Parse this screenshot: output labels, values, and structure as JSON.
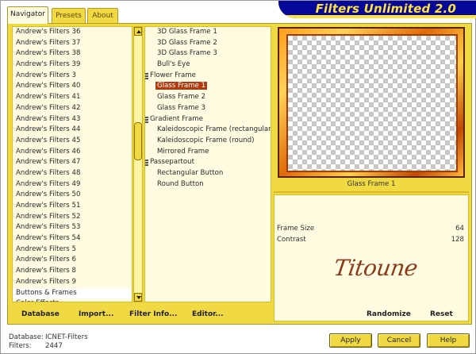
{
  "tabs": [
    {
      "label": "Navigator",
      "active": true
    },
    {
      "label": "Presets",
      "active": false
    },
    {
      "label": "About",
      "active": false
    }
  ],
  "logo_text": "Filters Unlimited 2.0",
  "categories": [
    "Andrew's Filters 36",
    "Andrew's Filters 37",
    "Andrew's Filters 38",
    "Andrew's Filters 39",
    "Andrew's Filters 3",
    "Andrew's Filters 40",
    "Andrew's Filters 41",
    "Andrew's Filters 42",
    "Andrew's Filters 43",
    "Andrew's Filters 44",
    "Andrew's Filters 45",
    "Andrew's Filters 46",
    "Andrew's Filters 47",
    "Andrew's Filters 48",
    "Andrew's Filters 49",
    "Andrew's Filters 50",
    "Andrew's Filters 51",
    "Andrew's Filters 52",
    "Andrew's Filters 53",
    "Andrew's Filters 54",
    "Andrew's Filters 5",
    "Andrew's Filters 6",
    "Andrew's Filters 8",
    "Andrew's Filters 9",
    "Buttons & Frames",
    "Color Effects"
  ],
  "selected_category": "Buttons & Frames",
  "filters": [
    {
      "label": "3D Glass Frame 1",
      "group": false
    },
    {
      "label": "3D Glass Frame 2",
      "group": false
    },
    {
      "label": "3D Glass Frame 3",
      "group": false
    },
    {
      "label": "Bull's Eye",
      "group": false
    },
    {
      "label": "Flower Frame",
      "group": true
    },
    {
      "label": "Glass Frame 1",
      "group": false,
      "selected": true
    },
    {
      "label": "Glass Frame 2",
      "group": false
    },
    {
      "label": "Glass Frame 3",
      "group": false
    },
    {
      "label": "Gradient Frame",
      "group": true
    },
    {
      "label": "Kaleidoscopic Frame (rectangular)",
      "group": false
    },
    {
      "label": "Kaleidoscopic Frame (round)",
      "group": false
    },
    {
      "label": "Mirrored Frame",
      "group": false
    },
    {
      "label": "Passepartout",
      "group": true
    },
    {
      "label": "Rectangular Button",
      "group": false
    },
    {
      "label": "Round Button",
      "group": false
    }
  ],
  "preview_caption": "Glass Frame 1",
  "params": [
    {
      "name": "Frame Size",
      "value": "64"
    },
    {
      "name": "Contrast",
      "value": "128"
    }
  ],
  "signature": "Titoune",
  "toolbar": {
    "database": "Database",
    "import": "Import...",
    "filter_info": "Filter Info...",
    "editor": "Editor...",
    "randomize": "Randomize",
    "reset": "Reset"
  },
  "footer": {
    "database_label": "Database:",
    "database_value": "ICNET-Filters",
    "filters_label": "Filters:",
    "filters_value": "2447"
  },
  "buttons": {
    "apply": "Apply",
    "cancel": "Cancel",
    "help": "Help"
  },
  "colors": {
    "accent_yellow": "#f1d943",
    "selection_brown": "#b33a0a",
    "logo_blue": "#06089a"
  }
}
